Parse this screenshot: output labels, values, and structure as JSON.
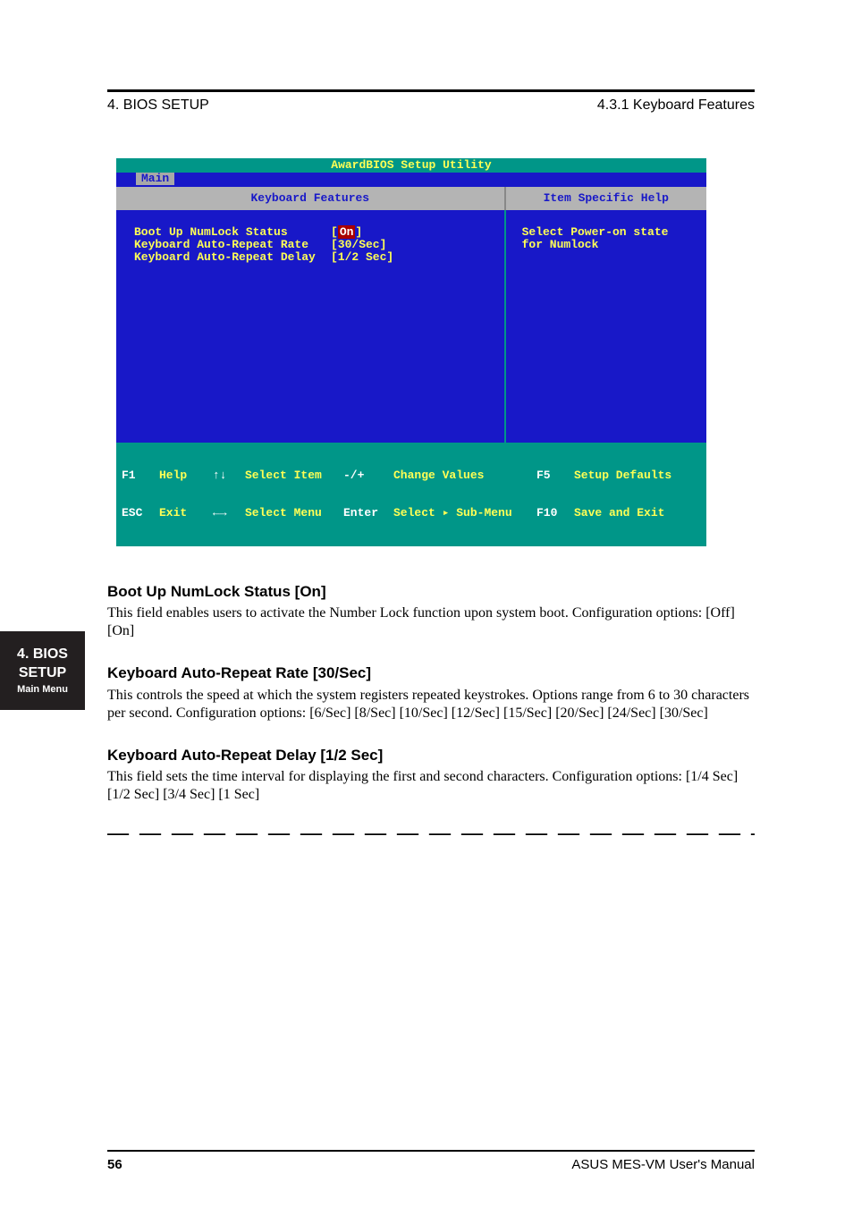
{
  "header": {
    "left": "4. BIOS SETUP",
    "right": "4.3.1 Keyboard Features"
  },
  "bios": {
    "title": "AwardBIOS Setup Utility",
    "tab": "Main",
    "panel_left_title": "Keyboard Features",
    "panel_right_title": "Item Specific Help",
    "rows": [
      {
        "label": "Boot Up NumLock Status",
        "value": "[On]",
        "hl": true
      },
      {
        "label": "Keyboard Auto-Repeat Rate",
        "value": "[30/Sec]",
        "hl": false
      },
      {
        "label": "Keyboard Auto-Repeat Delay",
        "value": "[1/2 Sec]",
        "hl": false
      }
    ],
    "help_text_l1": "Select Power-on state",
    "help_text_l2": "for Numlock",
    "footer": {
      "f1": "F1",
      "help": "Help",
      "esc": "ESC",
      "exit": "Exit",
      "updn": "↑↓",
      "selitem": "Select Item",
      "lr": "←→",
      "selmenu": "Select Menu",
      "pm": "-/+",
      "chg": "Change Values",
      "enter": "Enter",
      "sub": "Select ▸ Sub-Menu",
      "f5": "F5",
      "setdef": "Setup Defaults",
      "f10": "F10",
      "save": "Save and Exit"
    }
  },
  "sections": [
    {
      "heading": "Boot Up NumLock Status [On]",
      "para": "This field enables users to activate the Number Lock function upon system boot. Configuration options: [Off] [On]"
    },
    {
      "heading": "Keyboard Auto-Repeat Rate [30/Sec]",
      "para": "This controls the speed at which the system registers repeated keystrokes. Options range from 6 to 30 characters per second. Configuration options: [6/Sec] [8/Sec] [10/Sec] [12/Sec] [15/Sec] [20/Sec] [24/Sec] [30/Sec]"
    },
    {
      "heading": "Keyboard Auto-Repeat Delay [1/2 Sec]",
      "para": "This field sets the time interval for displaying the first and second characters. Configuration options: [1/4 Sec] [1/2 Sec] [3/4 Sec] [1 Sec]"
    }
  ],
  "sidebar": {
    "big": "4. BIOS SETUP",
    "small": "Main Menu"
  },
  "dashes": "— — — — — — — — — — — — — — — — — — — — — — —",
  "footer": {
    "left": "56",
    "right": "ASUS MES-VM User's Manual"
  }
}
